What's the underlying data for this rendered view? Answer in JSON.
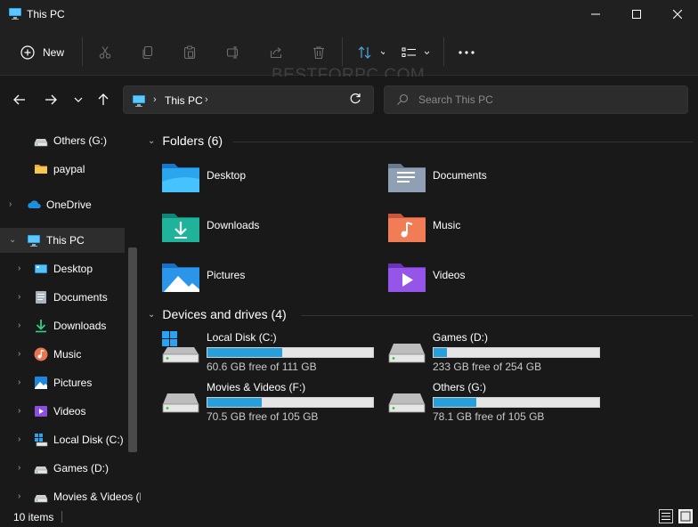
{
  "window": {
    "title": "This PC"
  },
  "toolbar": {
    "new_label": "New",
    "watermark": "BESTFORPC.COM"
  },
  "address": {
    "crumb": "This PC",
    "search_placeholder": "Search This PC"
  },
  "sidebar": {
    "items": [
      {
        "label": "Others (G:)",
        "icon": "drive-icon"
      },
      {
        "label": "paypal",
        "icon": "folder-icon"
      },
      {
        "label": "OneDrive",
        "icon": "onedrive-icon"
      },
      {
        "label": "This PC",
        "icon": "monitor-icon",
        "selected": true
      },
      {
        "label": "Desktop",
        "icon": "desktop-folder-icon"
      },
      {
        "label": "Documents",
        "icon": "documents-icon"
      },
      {
        "label": "Downloads",
        "icon": "download-icon"
      },
      {
        "label": "Music",
        "icon": "music-icon"
      },
      {
        "label": "Pictures",
        "icon": "pictures-icon"
      },
      {
        "label": "Videos",
        "icon": "videos-icon"
      },
      {
        "label": "Local Disk (C:)",
        "icon": "windows-drive-icon"
      },
      {
        "label": "Games (D:)",
        "icon": "drive-icon"
      },
      {
        "label": "Movies & Videos (F:)",
        "icon": "drive-icon"
      }
    ]
  },
  "main": {
    "folders_header": "Folders (6)",
    "folders": [
      {
        "label": "Desktop",
        "icon": "desktop-folder-icon"
      },
      {
        "label": "Documents",
        "icon": "documents-folder-icon"
      },
      {
        "label": "Downloads",
        "icon": "downloads-folder-icon"
      },
      {
        "label": "Music",
        "icon": "music-folder-icon"
      },
      {
        "label": "Pictures",
        "icon": "pictures-folder-icon"
      },
      {
        "label": "Videos",
        "icon": "videos-folder-icon"
      }
    ],
    "drives_header": "Devices and drives (4)",
    "drives": [
      {
        "label": "Local Disk (C:)",
        "free": "60.6 GB free of 111 GB",
        "used_fraction": 0.454
      },
      {
        "label": "Games (D:)",
        "free": "233 GB free of 254 GB",
        "used_fraction": 0.083
      },
      {
        "label": "Movies & Videos (F:)",
        "free": "70.5 GB free of 105 GB",
        "used_fraction": 0.329
      },
      {
        "label": "Others (G:)",
        "free": "78.1 GB free of 105 GB",
        "used_fraction": 0.256
      }
    ]
  },
  "status": {
    "count": "10 items"
  },
  "colors": {
    "accent": "#26a0da",
    "background": "#191919",
    "chrome": "#202020"
  }
}
